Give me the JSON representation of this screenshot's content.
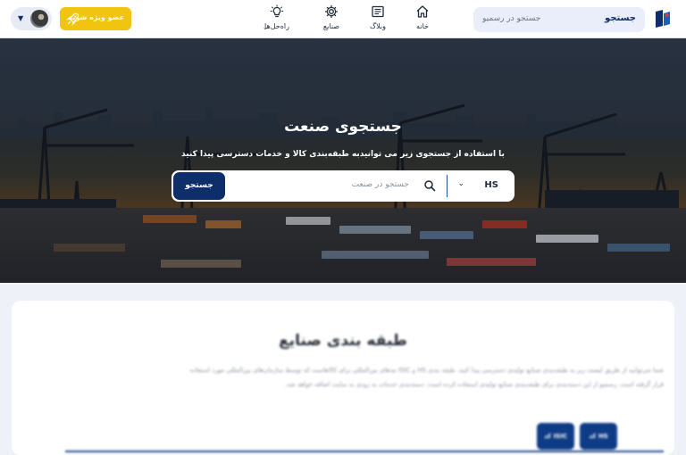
{
  "header": {
    "search": {
      "button_label": "جستجو",
      "placeholder": "جستجو در رسمیو"
    },
    "nav": [
      {
        "label": "خانه",
        "icon": "home-icon"
      },
      {
        "label": "وبلاگ",
        "icon": "blog-icon"
      },
      {
        "label": "صنایع",
        "icon": "gear-icon"
      },
      {
        "label": "راه‌حل‌ها",
        "icon": "lightbulb-icon"
      }
    ],
    "member_button": "عضو ویژه شوید",
    "user_menu_caret": "▼"
  },
  "hero": {
    "title": "جستجوی صنعت",
    "subtitle": "با استفاده از جستجوی زیر می توانیدبه طبقه‌بندی کالا و خدمات دسترسی پیدا کنید",
    "search": {
      "code_type": "HS",
      "placeholder": "جستجو در صنعت",
      "button_label": "جستجو"
    }
  },
  "categories": {
    "title": "طبقه بندی صنایع",
    "paragraph": "شما می‌توانید از طریق لیست زیر به طبقه‌بندی صنایع تولیدی دسترسی پیدا کنید. طبقه بندی HS و ISIC مدهای بین‌المللی برای کالاهاست که توسط سازمان‌های بین‌المللی مورد استفاده قرار گرفته است. رسمیو از این دسته‌بندی برای طبقه‌بندی صنایع تولیدی استفاده کرده است. دسته‌بندی خدمات به زودی به سایت اضافه خواهد شد.",
    "tabs": [
      "کد HS",
      "کد ISIC"
    ]
  },
  "colors": {
    "brand_navy": "#0d2d6b",
    "accent_yellow": "#f1c40f"
  }
}
